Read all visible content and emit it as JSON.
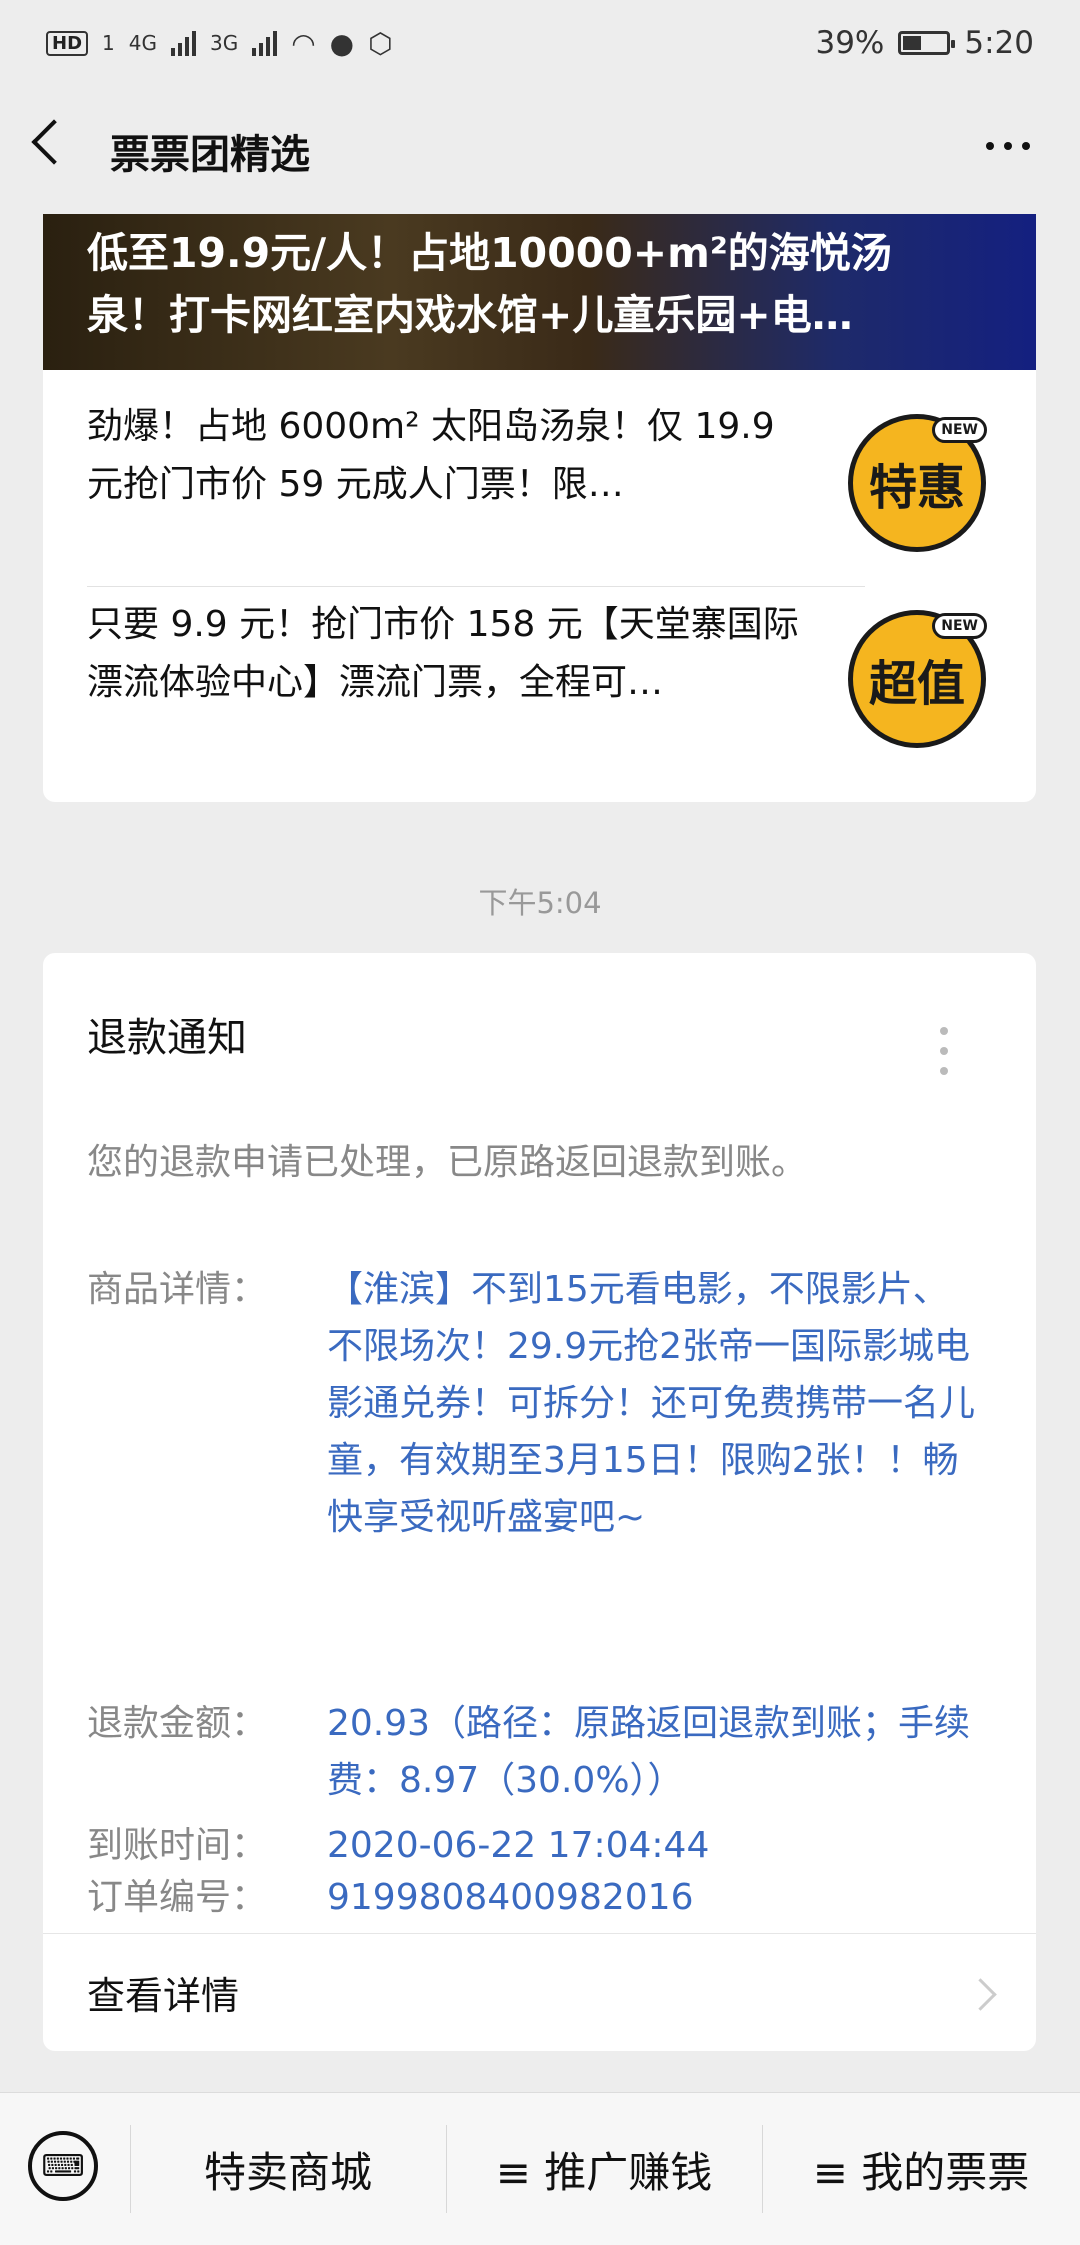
{
  "status_bar": {
    "left_badges": [
      "HD",
      "1",
      "4G",
      "3G"
    ],
    "battery": "39%",
    "time": "5:20"
  },
  "navbar": {
    "title": "票票团精选",
    "back_icon": "chevron-left-icon",
    "more_icon": "more-horizontal-icon"
  },
  "promo_card": {
    "banner_text": "低至19.9元/人！占地10000+m²的海悦汤泉！打卡网红室内戏水馆+儿童乐园+电…",
    "items": [
      {
        "text": "劲爆！占地 6000m² 太阳岛汤泉！仅 19.9 元抢门市价 59 元成人门票！限…",
        "badge": "特惠",
        "badge_tag": "NEW"
      },
      {
        "text": "只要 9.9 元！抢门市价 158 元【天堂寨国际漂流体验中心】漂流门票，全程可…",
        "badge": "超值",
        "badge_tag": "NEW"
      }
    ]
  },
  "timestamp": "下午5:04",
  "refund_card": {
    "title": "退款通知",
    "description": "您的退款申请已处理，已原路返回退款到账。",
    "fields": [
      {
        "label": "商品详情：",
        "value": "【淮滨】不到15元看电影，不限影片、不限场次！29.9元抢2张帝一国际影城电影通兑券！可拆分！还可免费携带一名儿童，有效期至3月15日！限购2张！！畅快享受视听盛宴吧~"
      },
      {
        "label": "退款金额：",
        "value": "20.93（路径：原路返回退款到账；手续费：8.97（30.0%））"
      },
      {
        "label": "到账时间：",
        "value": "2020-06-22 17:04:44"
      },
      {
        "label": "订单编号：",
        "value": "9199808400982016"
      }
    ],
    "detail_link": "查看详情"
  },
  "bottom_bar": {
    "keyboard_icon": "keyboard-icon",
    "menus": [
      "特卖商城",
      "≡ 推广赚钱",
      "≡ 我的票票"
    ]
  }
}
